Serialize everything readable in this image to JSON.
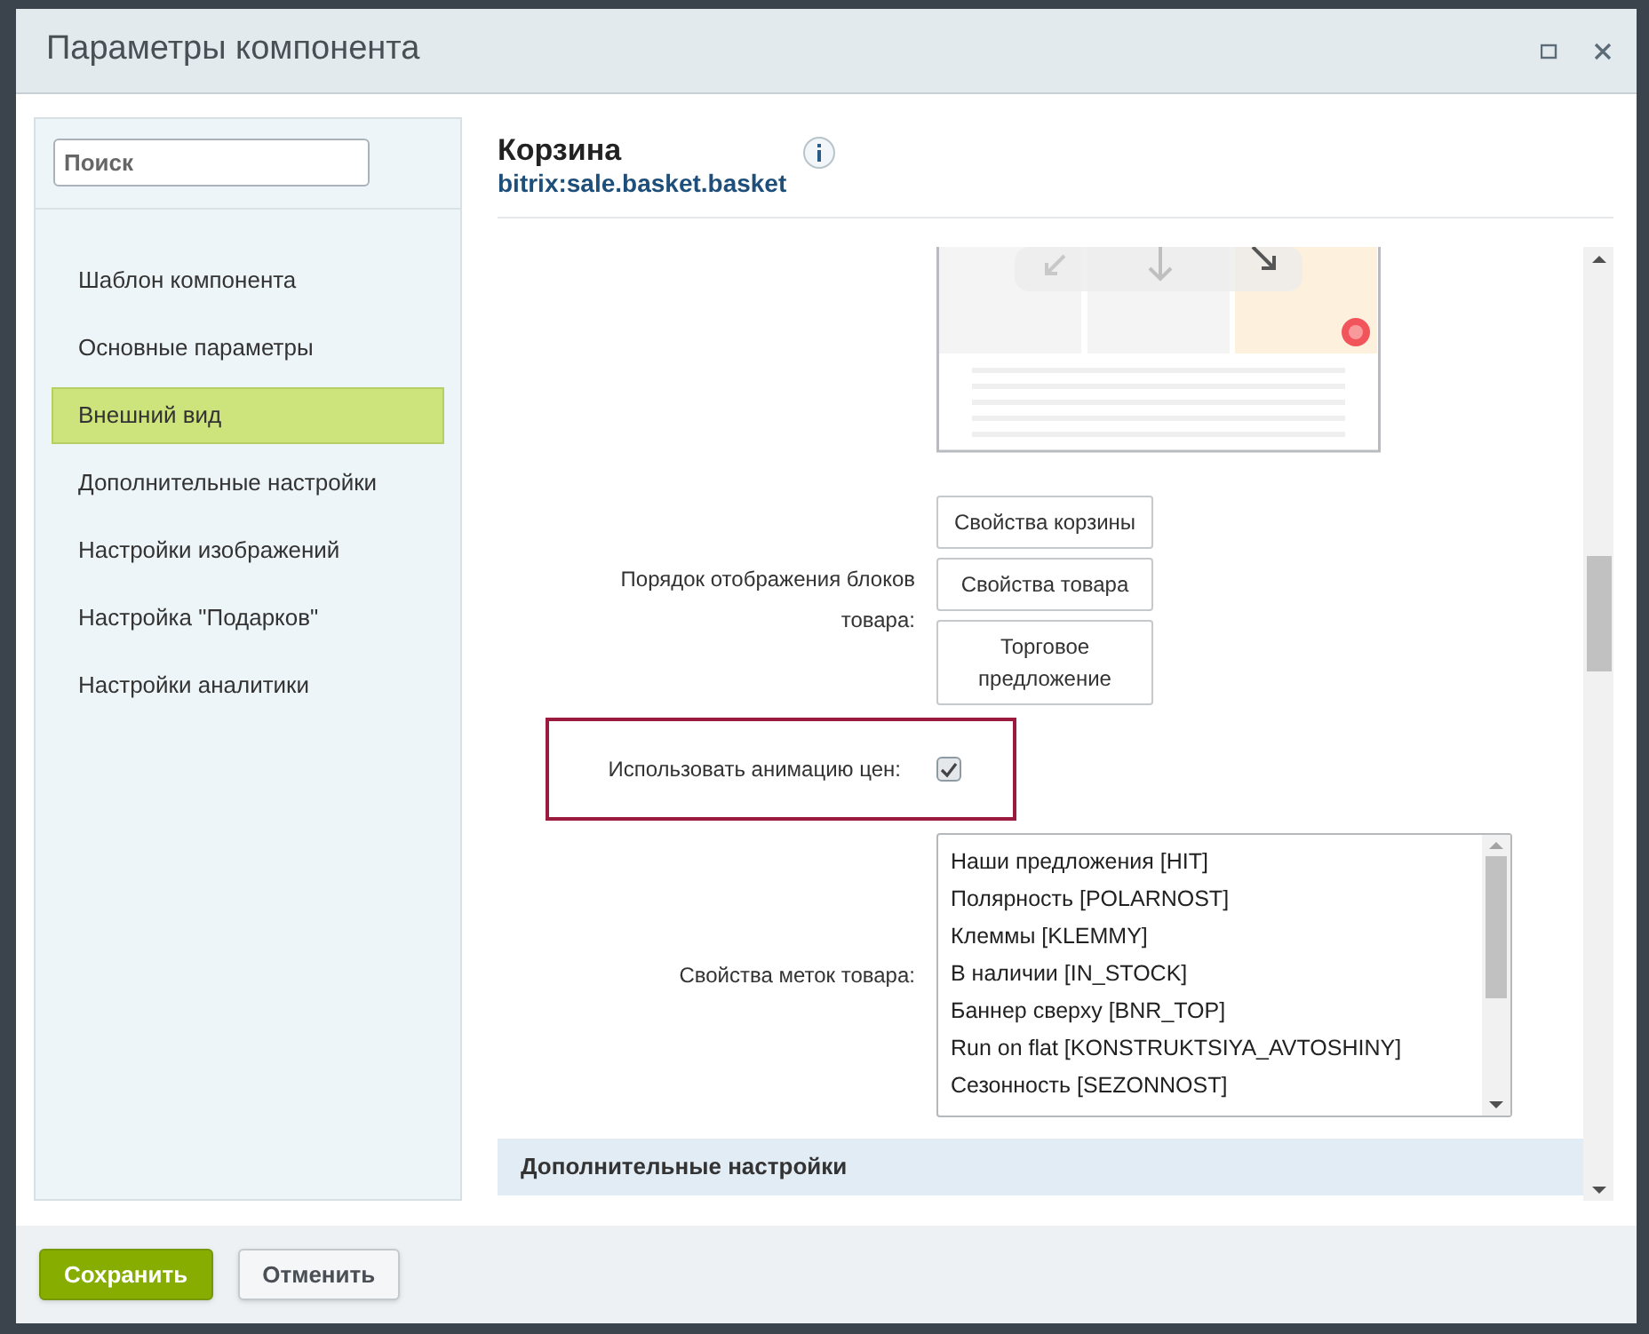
{
  "window": {
    "title": "Параметры компонента"
  },
  "sidebar": {
    "search": {
      "placeholder": "Поиск"
    },
    "items": [
      {
        "label": "Шаблон компонента",
        "selected": false
      },
      {
        "label": "Основные параметры",
        "selected": false
      },
      {
        "label": "Внешний вид",
        "selected": true
      },
      {
        "label": "Дополнительные настройки",
        "selected": false
      },
      {
        "label": "Настройки изображений",
        "selected": false
      },
      {
        "label": "Настройка \"Подарков\"",
        "selected": false
      },
      {
        "label": "Настройки аналитики",
        "selected": false
      }
    ]
  },
  "component": {
    "title": "Корзина",
    "code": "bitrix:sale.basket.basket"
  },
  "settings": {
    "block_order": {
      "label": "Порядок отображения блоков товара:",
      "buttons": [
        "Свойства корзины",
        "Свойства товара",
        "Торговое предложение"
      ]
    },
    "price_animation": {
      "label": "Использовать анимацию цен:",
      "checked": true
    },
    "label_properties": {
      "label": "Свойства меток товара:",
      "options": [
        {
          "label": "Наши предложения [HIT]",
          "selected": false
        },
        {
          "label": "Полярность [POLARNOST]",
          "selected": false
        },
        {
          "label": "Клеммы [KLEMMY]",
          "selected": false
        },
        {
          "label": "В наличии [IN_STOCK]",
          "selected": false
        },
        {
          "label": "Баннер сверху [BNR_TOP]",
          "selected": false
        },
        {
          "label": "Run on flat [KONSTRUKTSIYA_AVTOSHINY]",
          "selected": false
        },
        {
          "label": "Сезонность [SEZONNOST]",
          "selected": false
        }
      ]
    },
    "section": {
      "title": "Дополнительные настройки"
    }
  },
  "footer": {
    "buttons": [
      {
        "label": "Сохранить",
        "kind": "primary"
      },
      {
        "label": "Отменить",
        "kind": "secondary"
      }
    ]
  }
}
